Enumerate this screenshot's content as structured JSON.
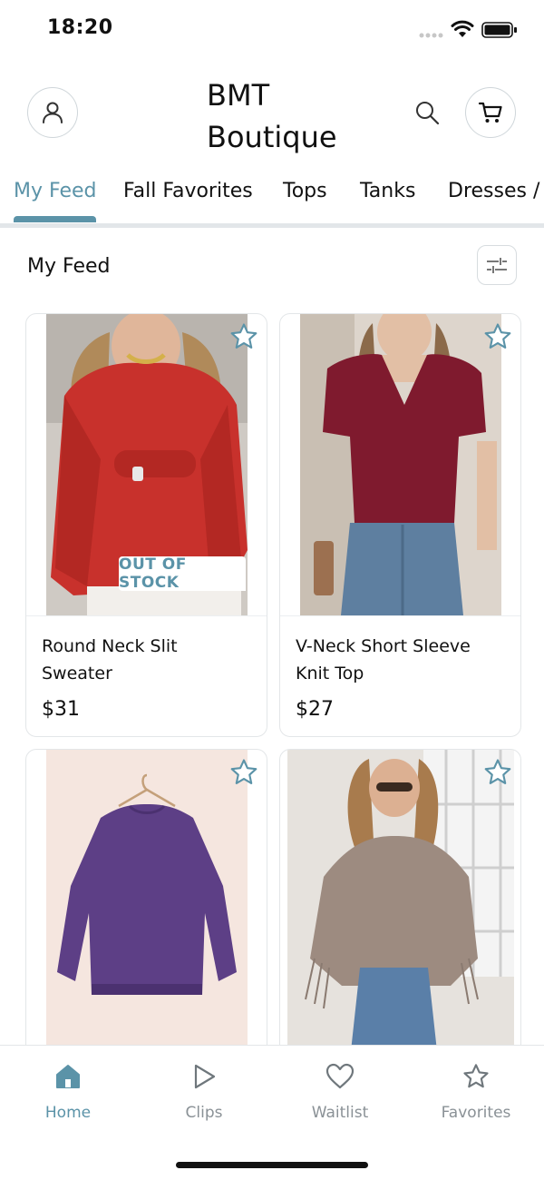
{
  "status_bar": {
    "time": "18:20"
  },
  "header": {
    "brand_line1": "BMT",
    "brand_line2": "Boutique"
  },
  "tabs": [
    {
      "label": "My Feed",
      "active": true
    },
    {
      "label": "Fall Favorites",
      "active": false
    },
    {
      "label": "Tops",
      "active": false
    },
    {
      "label": "Tanks",
      "active": false
    },
    {
      "label": "Dresses /",
      "active": false
    }
  ],
  "feed": {
    "title": "My Feed",
    "products": [
      {
        "name": "Round Neck Slit Sweater",
        "price": "$31",
        "badge": "OUT OF STOCK",
        "color": "#c8312c"
      },
      {
        "name": "V-Neck Short Sleeve Knit Top",
        "price": "$27",
        "badge": "",
        "color": "#7f1a2e"
      },
      {
        "name": "",
        "price": "",
        "badge": "",
        "color": "#5d3f86"
      },
      {
        "name": "",
        "price": "",
        "badge": "",
        "color": "#9d8b80"
      }
    ]
  },
  "bottom_nav": [
    {
      "label": "Home",
      "icon": "home-icon",
      "active": true
    },
    {
      "label": "Clips",
      "icon": "play-icon",
      "active": false
    },
    {
      "label": "Waitlist",
      "icon": "heart-icon",
      "active": false
    },
    {
      "label": "Favorites",
      "icon": "star-icon",
      "active": false
    }
  ],
  "colors": {
    "accent": "#5b93a8",
    "border": "#e3e6e8",
    "text": "#111111",
    "muted": "#8a9196"
  }
}
